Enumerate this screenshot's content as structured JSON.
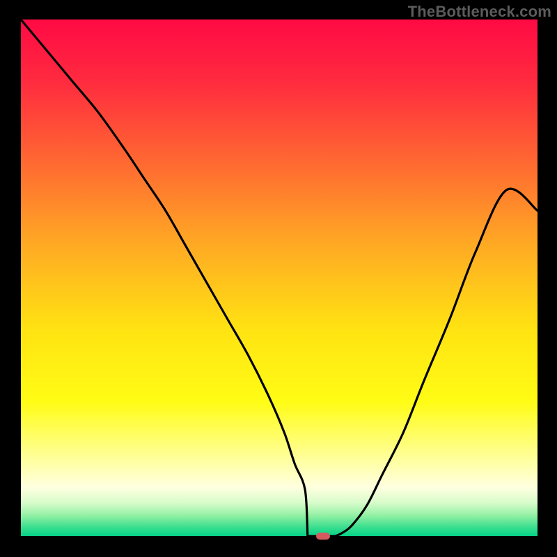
{
  "watermark": "TheBottleneck.com",
  "colors": {
    "black": "#000000",
    "marker": "#d55a5f",
    "curve": "#000000"
  },
  "chart_data": {
    "type": "line",
    "title": "",
    "xlabel": "",
    "ylabel": "",
    "xlim": [
      0,
      100
    ],
    "ylim": [
      0,
      100
    ],
    "gradient_stops": [
      {
        "offset": 0.0,
        "color": "#ff0a44"
      },
      {
        "offset": 0.12,
        "color": "#ff2b3f"
      },
      {
        "offset": 0.28,
        "color": "#ff6a31"
      },
      {
        "offset": 0.44,
        "color": "#ffab23"
      },
      {
        "offset": 0.6,
        "color": "#ffe312"
      },
      {
        "offset": 0.74,
        "color": "#fffc15"
      },
      {
        "offset": 0.86,
        "color": "#ffffa8"
      },
      {
        "offset": 0.905,
        "color": "#ffffe0"
      },
      {
        "offset": 0.935,
        "color": "#d9fccb"
      },
      {
        "offset": 0.96,
        "color": "#93f0a4"
      },
      {
        "offset": 0.985,
        "color": "#32dd8d"
      },
      {
        "offset": 1.0,
        "color": "#05d288"
      }
    ],
    "series": [
      {
        "name": "bottleneck-curve",
        "x": [
          0,
          5,
          10,
          15,
          20,
          24,
          28,
          32,
          36,
          40,
          44,
          48,
          51,
          53,
          55,
          56.5,
          58,
          59.2,
          60.5,
          62,
          64,
          67,
          70,
          74,
          78,
          83,
          88,
          94,
          100
        ],
        "y": [
          100,
          94,
          88,
          82,
          75,
          69,
          63,
          56,
          49,
          42,
          35,
          27,
          20,
          14,
          9,
          5,
          2,
          0.8,
          0,
          0.5,
          2,
          6,
          12,
          20,
          30,
          42,
          55,
          67,
          63
        ]
      }
    ],
    "baseline_start_x": 55.5,
    "baseline_end_x": 60.8,
    "marker": {
      "x": 58.5,
      "y": 0
    }
  }
}
